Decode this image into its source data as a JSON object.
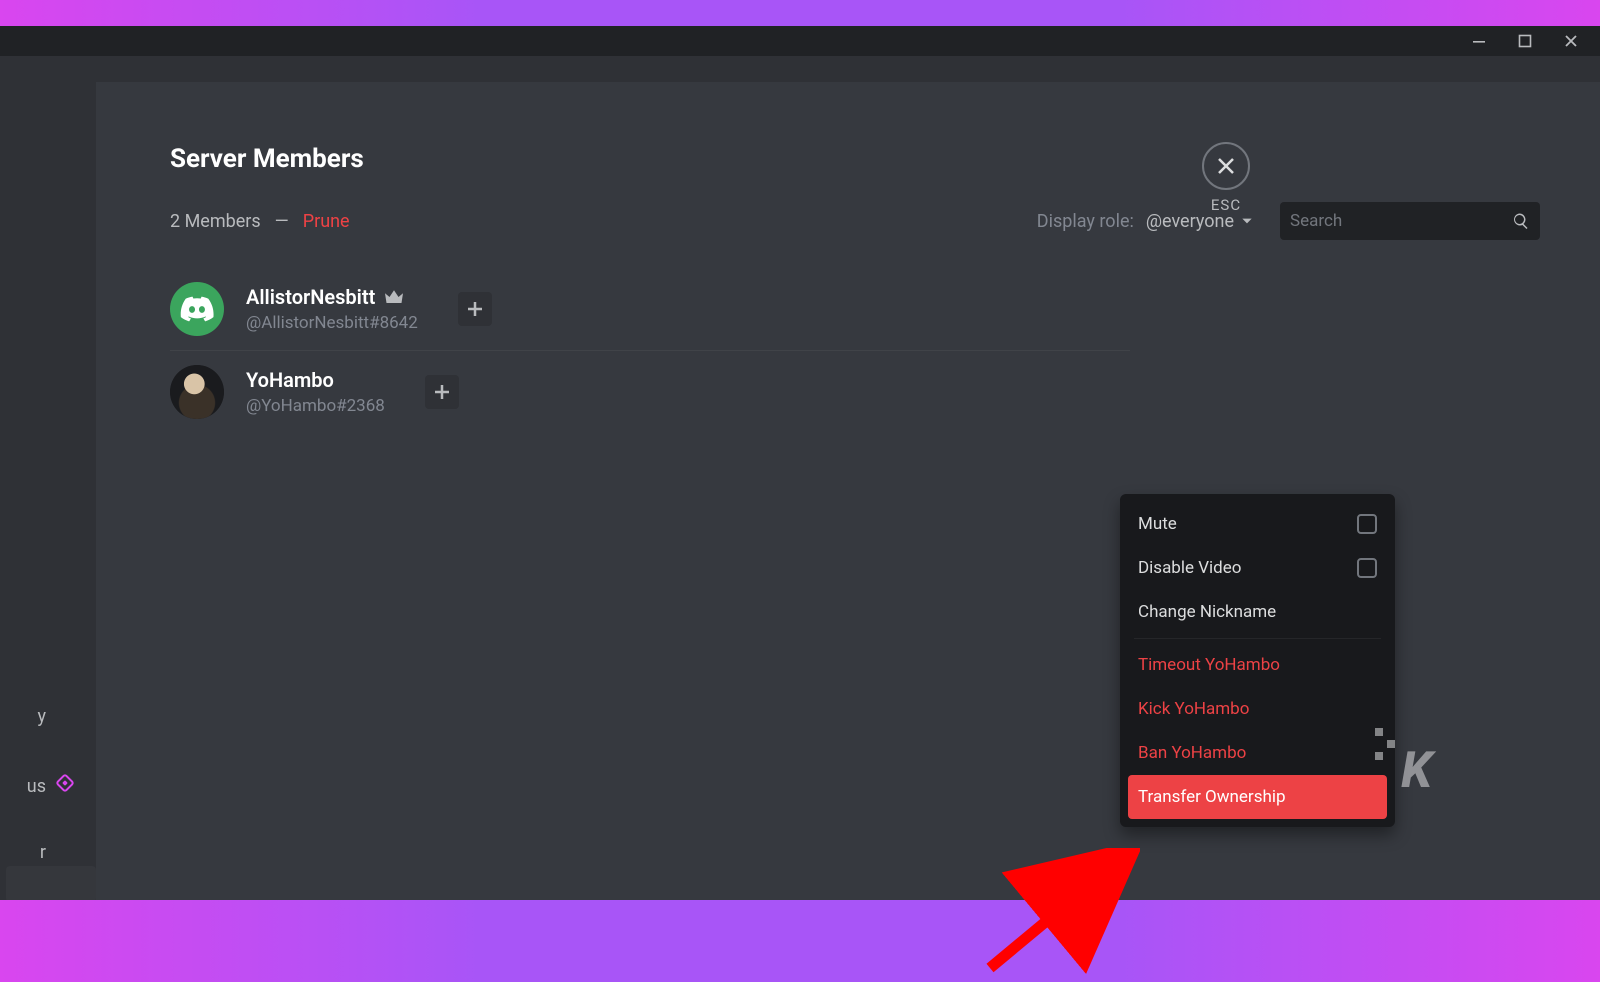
{
  "page_title": "Server Members",
  "member_count_text": "2 Members",
  "prune_label": "Prune",
  "display_role_label": "Display role:",
  "role_dropdown_value": "@everyone",
  "search_placeholder": "Search",
  "close_hint": "ESC",
  "members": [
    {
      "name": "AllistorNesbitt",
      "tag": "@AllistorNesbitt#8642",
      "owner": true,
      "avatar": "default"
    },
    {
      "name": "YoHambo",
      "tag": "@YoHambo#2368",
      "owner": false,
      "avatar": "photo"
    }
  ],
  "context_menu": {
    "mute": "Mute",
    "disable_video": "Disable Video",
    "change_nick": "Change Nickname",
    "timeout": "Timeout YoHambo",
    "kick": "Kick YoHambo",
    "ban": "Ban YoHambo",
    "transfer": "Transfer Ownership"
  },
  "sidebar_fragments": {
    "y": "y",
    "us": "us",
    "r": "r"
  },
  "watermark": "K"
}
